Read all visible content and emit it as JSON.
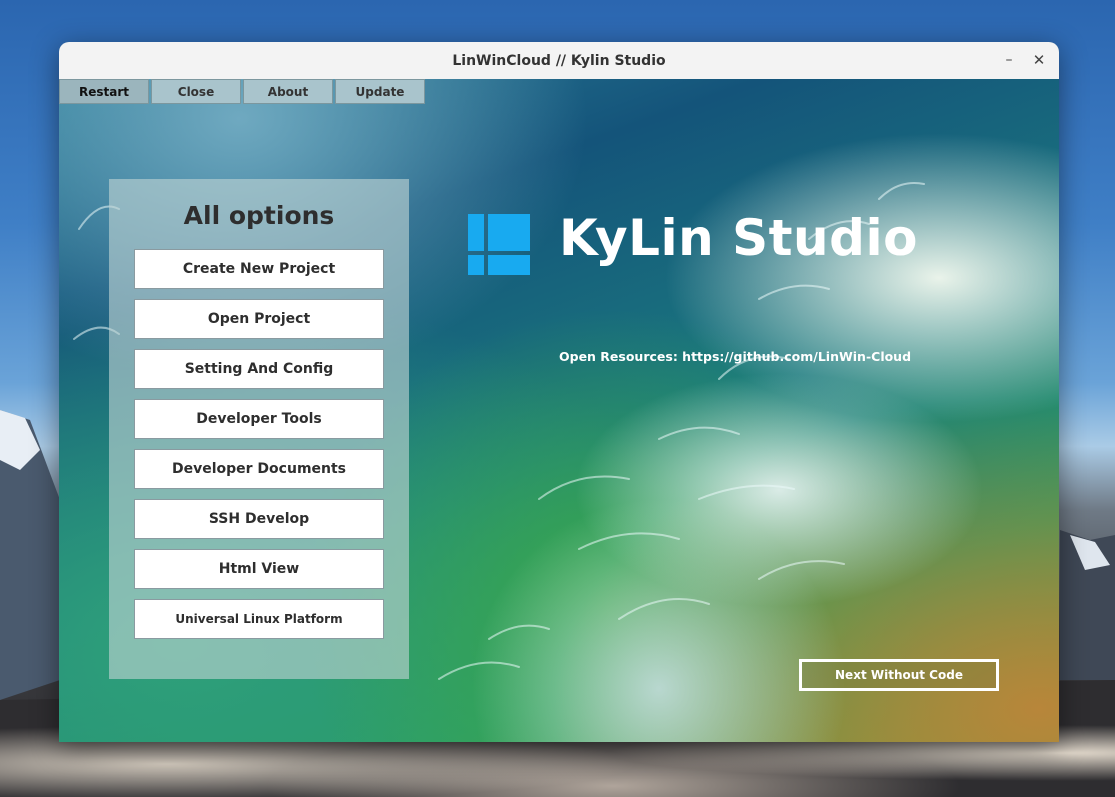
{
  "window": {
    "title": "LinWinCloud // Kylin Studio",
    "minimize_glyph": "–",
    "close_glyph": "✕"
  },
  "menubar": [
    {
      "label": "Restart"
    },
    {
      "label": "Close"
    },
    {
      "label": "About"
    },
    {
      "label": "Update"
    }
  ],
  "options": {
    "title": "All options",
    "items": [
      {
        "label": "Create New Project"
      },
      {
        "label": "Open Project"
      },
      {
        "label": "Setting And Config"
      },
      {
        "label": "Developer Tools"
      },
      {
        "label": "Developer Documents"
      },
      {
        "label": "SSH Develop"
      },
      {
        "label": "Html View"
      },
      {
        "label": "Universal Linux Platform"
      }
    ]
  },
  "brand": {
    "name": "KyLin Studio",
    "logo_icon": "windows-logo-icon",
    "logo_color": "#18aaf0"
  },
  "resources_text": "Open Resources: https://github.com/LinWin-Cloud",
  "next_button_label": "Next Without Code"
}
